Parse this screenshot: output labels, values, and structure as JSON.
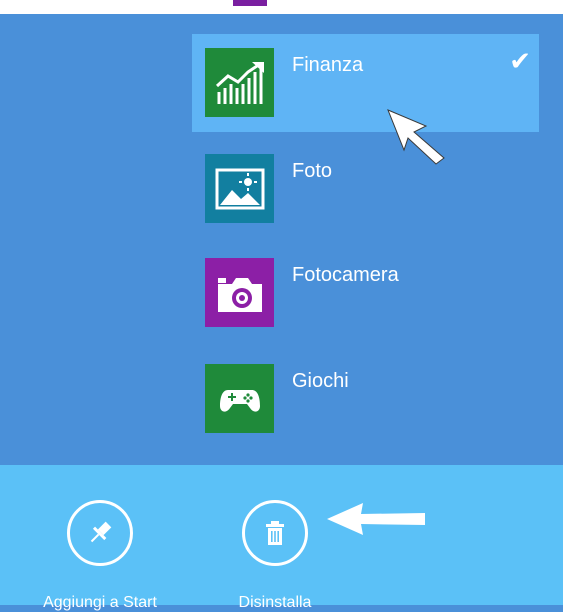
{
  "apps": [
    {
      "label": "Finanza",
      "icon": "finance-chart-icon",
      "tile_color": "#1f8a3a",
      "selected": true
    },
    {
      "label": "Foto",
      "icon": "photo-icon",
      "tile_color": "#127fa0",
      "selected": false
    },
    {
      "label": "Fotocamera",
      "icon": "camera-icon",
      "tile_color": "#8c1fa6",
      "selected": false
    },
    {
      "label": "Giochi",
      "icon": "gamepad-icon",
      "tile_color": "#1f8a3a",
      "selected": false
    }
  ],
  "selection_mark": "✔",
  "app_bar": {
    "pin_label": "Aggiungi a Start",
    "pin_icon": "pin-icon",
    "uninstall_label": "Disinstalla",
    "uninstall_icon": "trash-icon"
  },
  "colors": {
    "background": "#4a90d9",
    "selected_row": "#5fb4f5",
    "app_bar": "#5bc1f7"
  }
}
